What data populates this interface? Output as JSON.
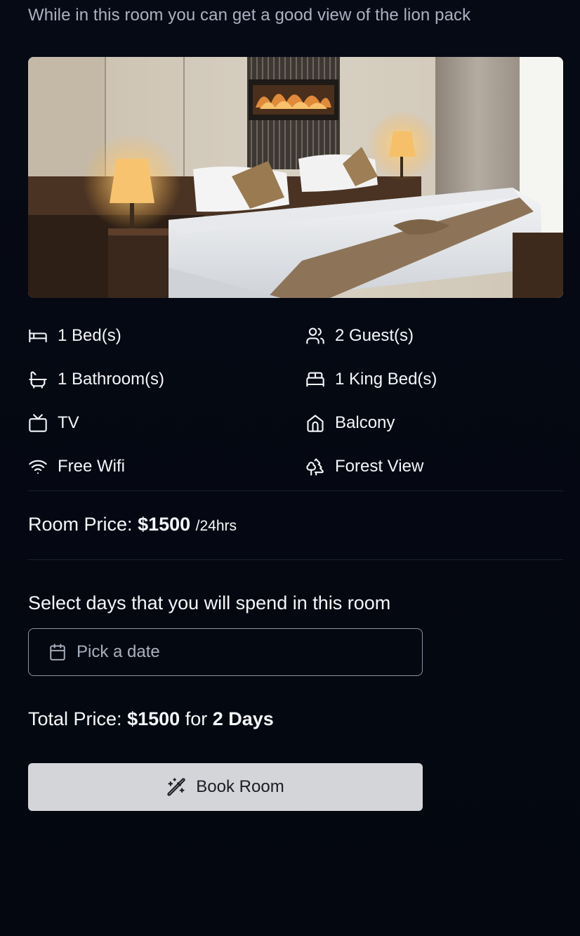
{
  "room": {
    "description": "While in this room you can get a good view of the lion pack",
    "image_alt": "Hotel room with king bed and lamps"
  },
  "amenities": [
    {
      "icon": "bed-icon",
      "label": "1 Bed(s)"
    },
    {
      "icon": "users-icon",
      "label": "2 Guest(s)"
    },
    {
      "icon": "bath-icon",
      "label": "1 Bathroom(s)"
    },
    {
      "icon": "bed-double-icon",
      "label": "1 King Bed(s)"
    },
    {
      "icon": "tv-icon",
      "label": "TV"
    },
    {
      "icon": "home-icon",
      "label": "Balcony"
    },
    {
      "icon": "wifi-icon",
      "label": "Free Wifi"
    },
    {
      "icon": "trees-icon",
      "label": "Forest View"
    }
  ],
  "pricing": {
    "room_price_label": "Room Price:",
    "room_price_amount": "$1500",
    "room_price_unit": "/24hrs",
    "select_days_label": "Select days that you will spend in this room",
    "date_placeholder": "Pick a date",
    "total_label": "Total Price:",
    "total_amount": "$1500",
    "total_for": "for",
    "total_days": "2 Days"
  },
  "actions": {
    "book_label": "Book Room"
  }
}
